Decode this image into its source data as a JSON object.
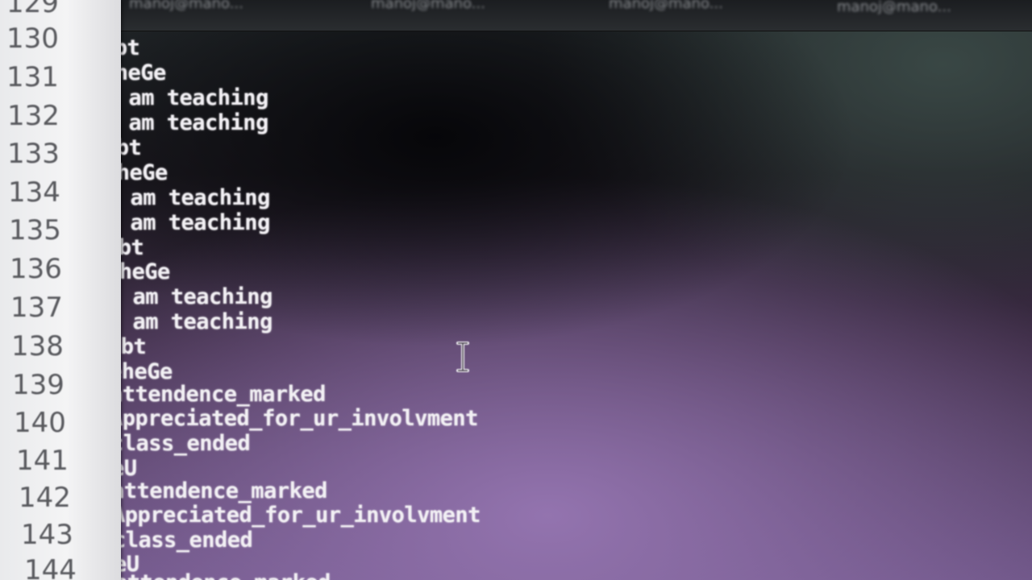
{
  "terminal": {
    "tabs": [
      {
        "label": "manoj@mano..."
      },
      {
        "label": "manoj@mano..."
      },
      {
        "label": "manoj@mano..."
      },
      {
        "label": "manoj@mano..."
      }
    ],
    "output_lines": [
      "ubt",
      "eheGe",
      "I am teaching",
      "I am teaching",
      "ubt",
      "eheGe",
      "I am teaching",
      "I am teaching",
      "ubt",
      "eheGe",
      "I am teaching",
      "I am teaching",
      "ubt",
      "eheGe",
      "attendence_marked",
      "Appreciated_for_ur_involvment",
      "class_ended",
      "eU",
      "attendence_marked",
      "Appreciated_for_ur_involvment",
      "class_ended",
      "eU",
      "attendence_marked"
    ]
  },
  "editor_gutter": {
    "line_numbers": [
      "129",
      "130",
      "131",
      "132",
      "133",
      "134",
      "135",
      "136",
      "137",
      "138",
      "139",
      "140",
      "141",
      "142",
      "143",
      "144"
    ]
  },
  "cursor": {
    "icon": "i-beam-cursor-icon"
  }
}
